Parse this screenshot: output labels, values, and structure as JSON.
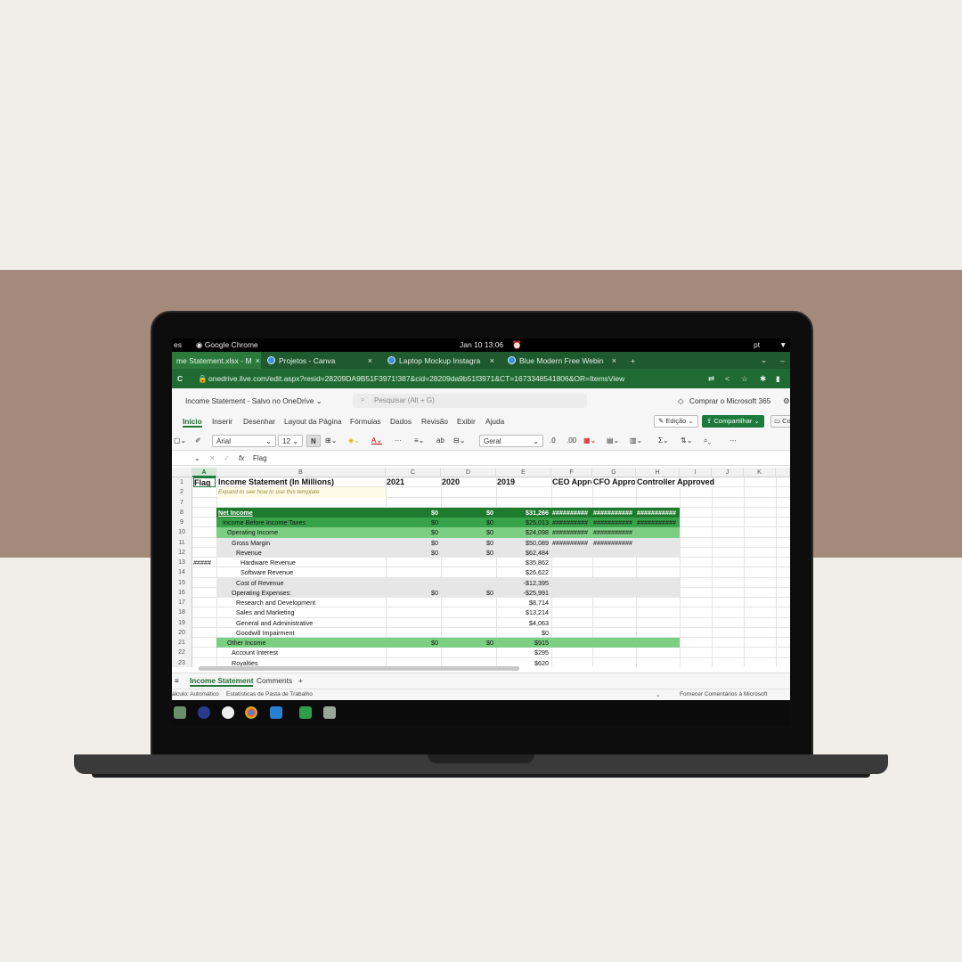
{
  "os": {
    "left_fragment": "es",
    "app": "Google Chrome",
    "clock": "Jan 10  13:06",
    "lang": "pt"
  },
  "tabs": [
    {
      "label": "me Statement.xlsx - M",
      "close": "×"
    },
    {
      "label": "Projetos - Canva",
      "close": "×"
    },
    {
      "label": "Laptop Mockup Instagra",
      "close": "×"
    },
    {
      "label": "Blue Modern Free Webin",
      "close": "×"
    }
  ],
  "new_tab": "+",
  "address": {
    "url": "onedrive.live.com/edit.aspx?resid=28209DA9B51F3971!387&cid=28209da9b51f3971&CT=1673348541806&OR=ItemsView"
  },
  "excel": {
    "doc_title": "Income Statement  -  Salvo no OneDrive ⌄",
    "search_placeholder": "Pesquisar (Alt + G)",
    "buy": "Comprar o Microsoft 365",
    "menu": [
      "Início",
      "Inserir",
      "Desenhar",
      "Layout da Página",
      "Fórmulas",
      "Dados",
      "Revisão",
      "Exibir",
      "Ajuda"
    ],
    "edit_btn": "Edição ⌄",
    "share_btn": "Compartilhar ⌄",
    "comments_btn": "Co",
    "font": "Arial",
    "font_size": "12",
    "bold": "N",
    "number_format": "Geral",
    "name_box": "⌄",
    "fx": "fx",
    "formula": "Flag"
  },
  "columns": [
    "A",
    "B",
    "C",
    "D",
    "E",
    "F",
    "G",
    "H",
    "I",
    "J",
    "K"
  ],
  "rows": [
    {
      "n": "1",
      "a": "Flag",
      "b": "Income Statement (In Millions)",
      "c": "2021",
      "d": "2020",
      "e": "2019",
      "f": "CEO Appro",
      "g": "CFO Appro",
      "h": "Controller Approved",
      "style": "header"
    },
    {
      "n": "2",
      "a": "",
      "b": "Expand to see how to use this template",
      "c": "",
      "d": "",
      "e": "",
      "f": "",
      "g": "",
      "h": "",
      "style": "note"
    },
    {
      "n": "7",
      "a": "",
      "b": "",
      "c": "",
      "d": "",
      "e": "",
      "f": "",
      "g": "",
      "h": "",
      "style": "plain"
    },
    {
      "n": "8",
      "a": "",
      "b": "Net Income",
      "c": "$0",
      "d": "$0",
      "e": "$31,266",
      "f": "##########",
      "g": "###########",
      "h": "###########",
      "style": "dark",
      "indent": 0
    },
    {
      "n": "9",
      "a": "",
      "b": "Income Before Income Taxes",
      "c": "$0",
      "d": "$0",
      "e": "$25,013",
      "f": "##########",
      "g": "###########",
      "h": "###########",
      "style": "mid",
      "indent": 1
    },
    {
      "n": "10",
      "a": "",
      "b": "Operating Income",
      "c": "$0",
      "d": "$0",
      "e": "$24,098",
      "f": "##########",
      "g": "###########",
      "h": "",
      "style": "light",
      "indent": 2
    },
    {
      "n": "11",
      "a": "",
      "b": "Gross Margin",
      "c": "$0",
      "d": "$0",
      "e": "$50,089",
      "f": "##########",
      "g": "###########",
      "h": "",
      "style": "gray",
      "indent": 3
    },
    {
      "n": "12",
      "a": "",
      "b": "Revenue",
      "c": "$0",
      "d": "$0",
      "e": "$62,484",
      "f": "",
      "g": "",
      "h": "",
      "style": "gray",
      "indent": 4
    },
    {
      "n": "13",
      "a": "#####",
      "b": "Hardware Revenue",
      "c": "",
      "d": "",
      "e": "$35,862",
      "f": "",
      "g": "",
      "h": "",
      "style": "plain",
      "indent": 5
    },
    {
      "n": "14",
      "a": "",
      "b": "Software Revenue",
      "c": "",
      "d": "",
      "e": "$26,622",
      "f": "",
      "g": "",
      "h": "",
      "style": "plain",
      "indent": 5
    },
    {
      "n": "15",
      "a": "",
      "b": "Cost of Revenue",
      "c": "",
      "d": "",
      "e": "-$12,395",
      "f": "",
      "g": "",
      "h": "",
      "style": "gray",
      "indent": 4
    },
    {
      "n": "16",
      "a": "",
      "b": "Operating Expenses:",
      "c": "$0",
      "d": "$0",
      "e": "-$25,991",
      "f": "",
      "g": "",
      "h": "",
      "style": "gray",
      "indent": 3
    },
    {
      "n": "17",
      "a": "",
      "b": "Research and Development",
      "c": "",
      "d": "",
      "e": "$8,714",
      "f": "",
      "g": "",
      "h": "",
      "style": "plain",
      "indent": 4
    },
    {
      "n": "18",
      "a": "",
      "b": "Sales and Marketing",
      "c": "",
      "d": "",
      "e": "$13,214",
      "f": "",
      "g": "",
      "h": "",
      "style": "plain",
      "indent": 4
    },
    {
      "n": "19",
      "a": "",
      "b": "General and Administrative",
      "c": "",
      "d": "",
      "e": "$4,063",
      "f": "",
      "g": "",
      "h": "",
      "style": "plain",
      "indent": 4
    },
    {
      "n": "20",
      "a": "",
      "b": "Goodwill Impairment",
      "c": "",
      "d": "",
      "e": "$0",
      "f": "",
      "g": "",
      "h": "",
      "style": "plain",
      "indent": 4
    },
    {
      "n": "21",
      "a": "",
      "b": "Other Income",
      "c": "$0",
      "d": "$0",
      "e": "$915",
      "f": "",
      "g": "",
      "h": "",
      "style": "light",
      "indent": 2
    },
    {
      "n": "22",
      "a": "",
      "b": "Account Interest",
      "c": "",
      "d": "",
      "e": "$295",
      "f": "",
      "g": "",
      "h": "",
      "style": "plain",
      "indent": 3
    },
    {
      "n": "23",
      "a": "",
      "b": "Royalties",
      "c": "",
      "d": "",
      "e": "$620",
      "f": "",
      "g": "",
      "h": "",
      "style": "plain",
      "indent": 3
    }
  ],
  "sheets": {
    "active": "Income Statement",
    "other": "Comments",
    "add": "+"
  },
  "status": {
    "calc": "álculo: Automático",
    "stats": "Estatísticas de Pasta de Trabalho",
    "feedback": "Fornecer Comentários à Microsoft"
  },
  "colors": {
    "dark_green": "#1e7a2c",
    "mid_green": "#38a24a",
    "light_green": "#7ccf82",
    "gray_row": "#e6e6e6",
    "accent": "#1e7a3c"
  }
}
